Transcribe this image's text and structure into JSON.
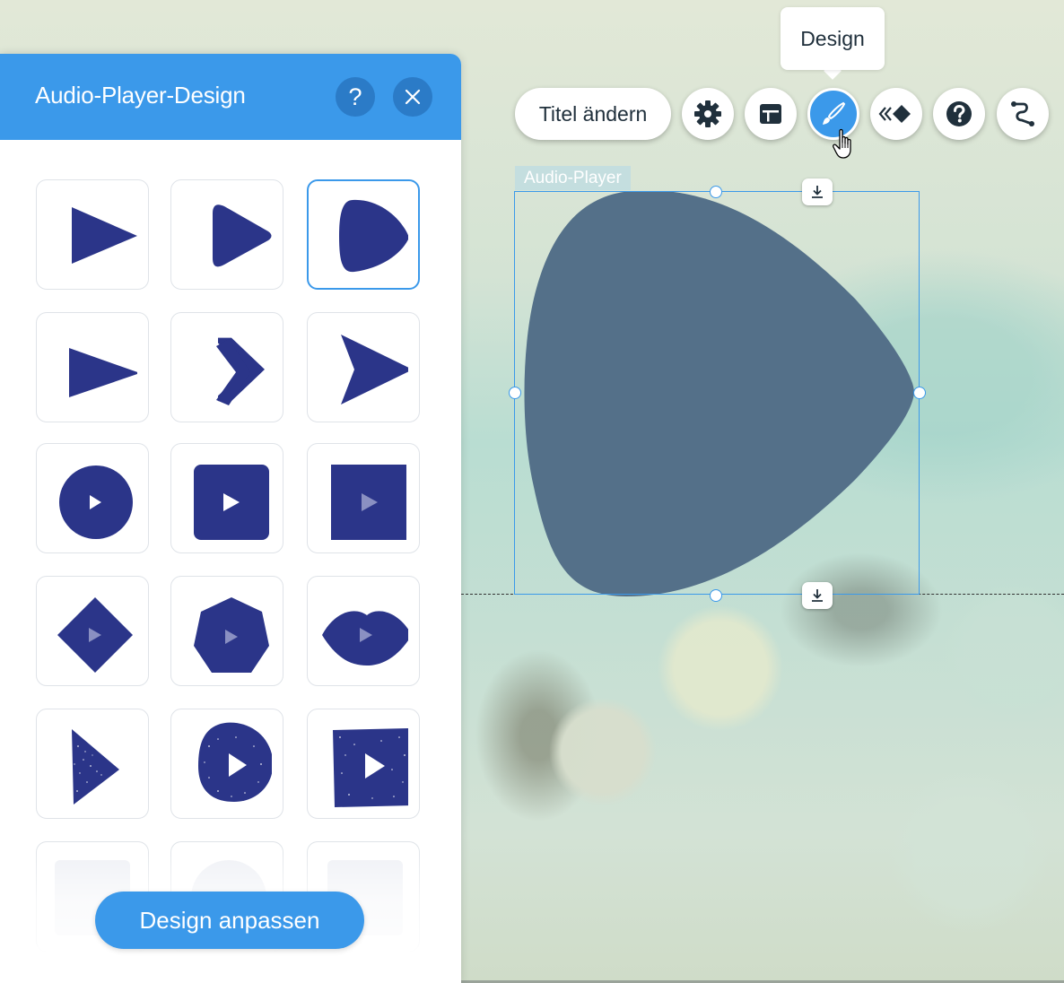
{
  "panel": {
    "title": "Audio-Player-Design",
    "help_icon": "help-icon",
    "close_icon": "close-icon",
    "customize_label": "Design anpassen",
    "selected_design_index": 2,
    "accent_color": "#3b99ea",
    "shape_color": "#2b3589"
  },
  "toolbar": {
    "change_title_label": "Titel ändern",
    "tooltip": "Design",
    "icons": [
      "settings-icon",
      "layout-icon",
      "design-brush-icon",
      "animation-icon",
      "help-icon",
      "connect-icon"
    ],
    "active_icon": "design-brush-icon"
  },
  "canvas": {
    "element_label": "Audio-Player",
    "element_color": "#547089"
  }
}
